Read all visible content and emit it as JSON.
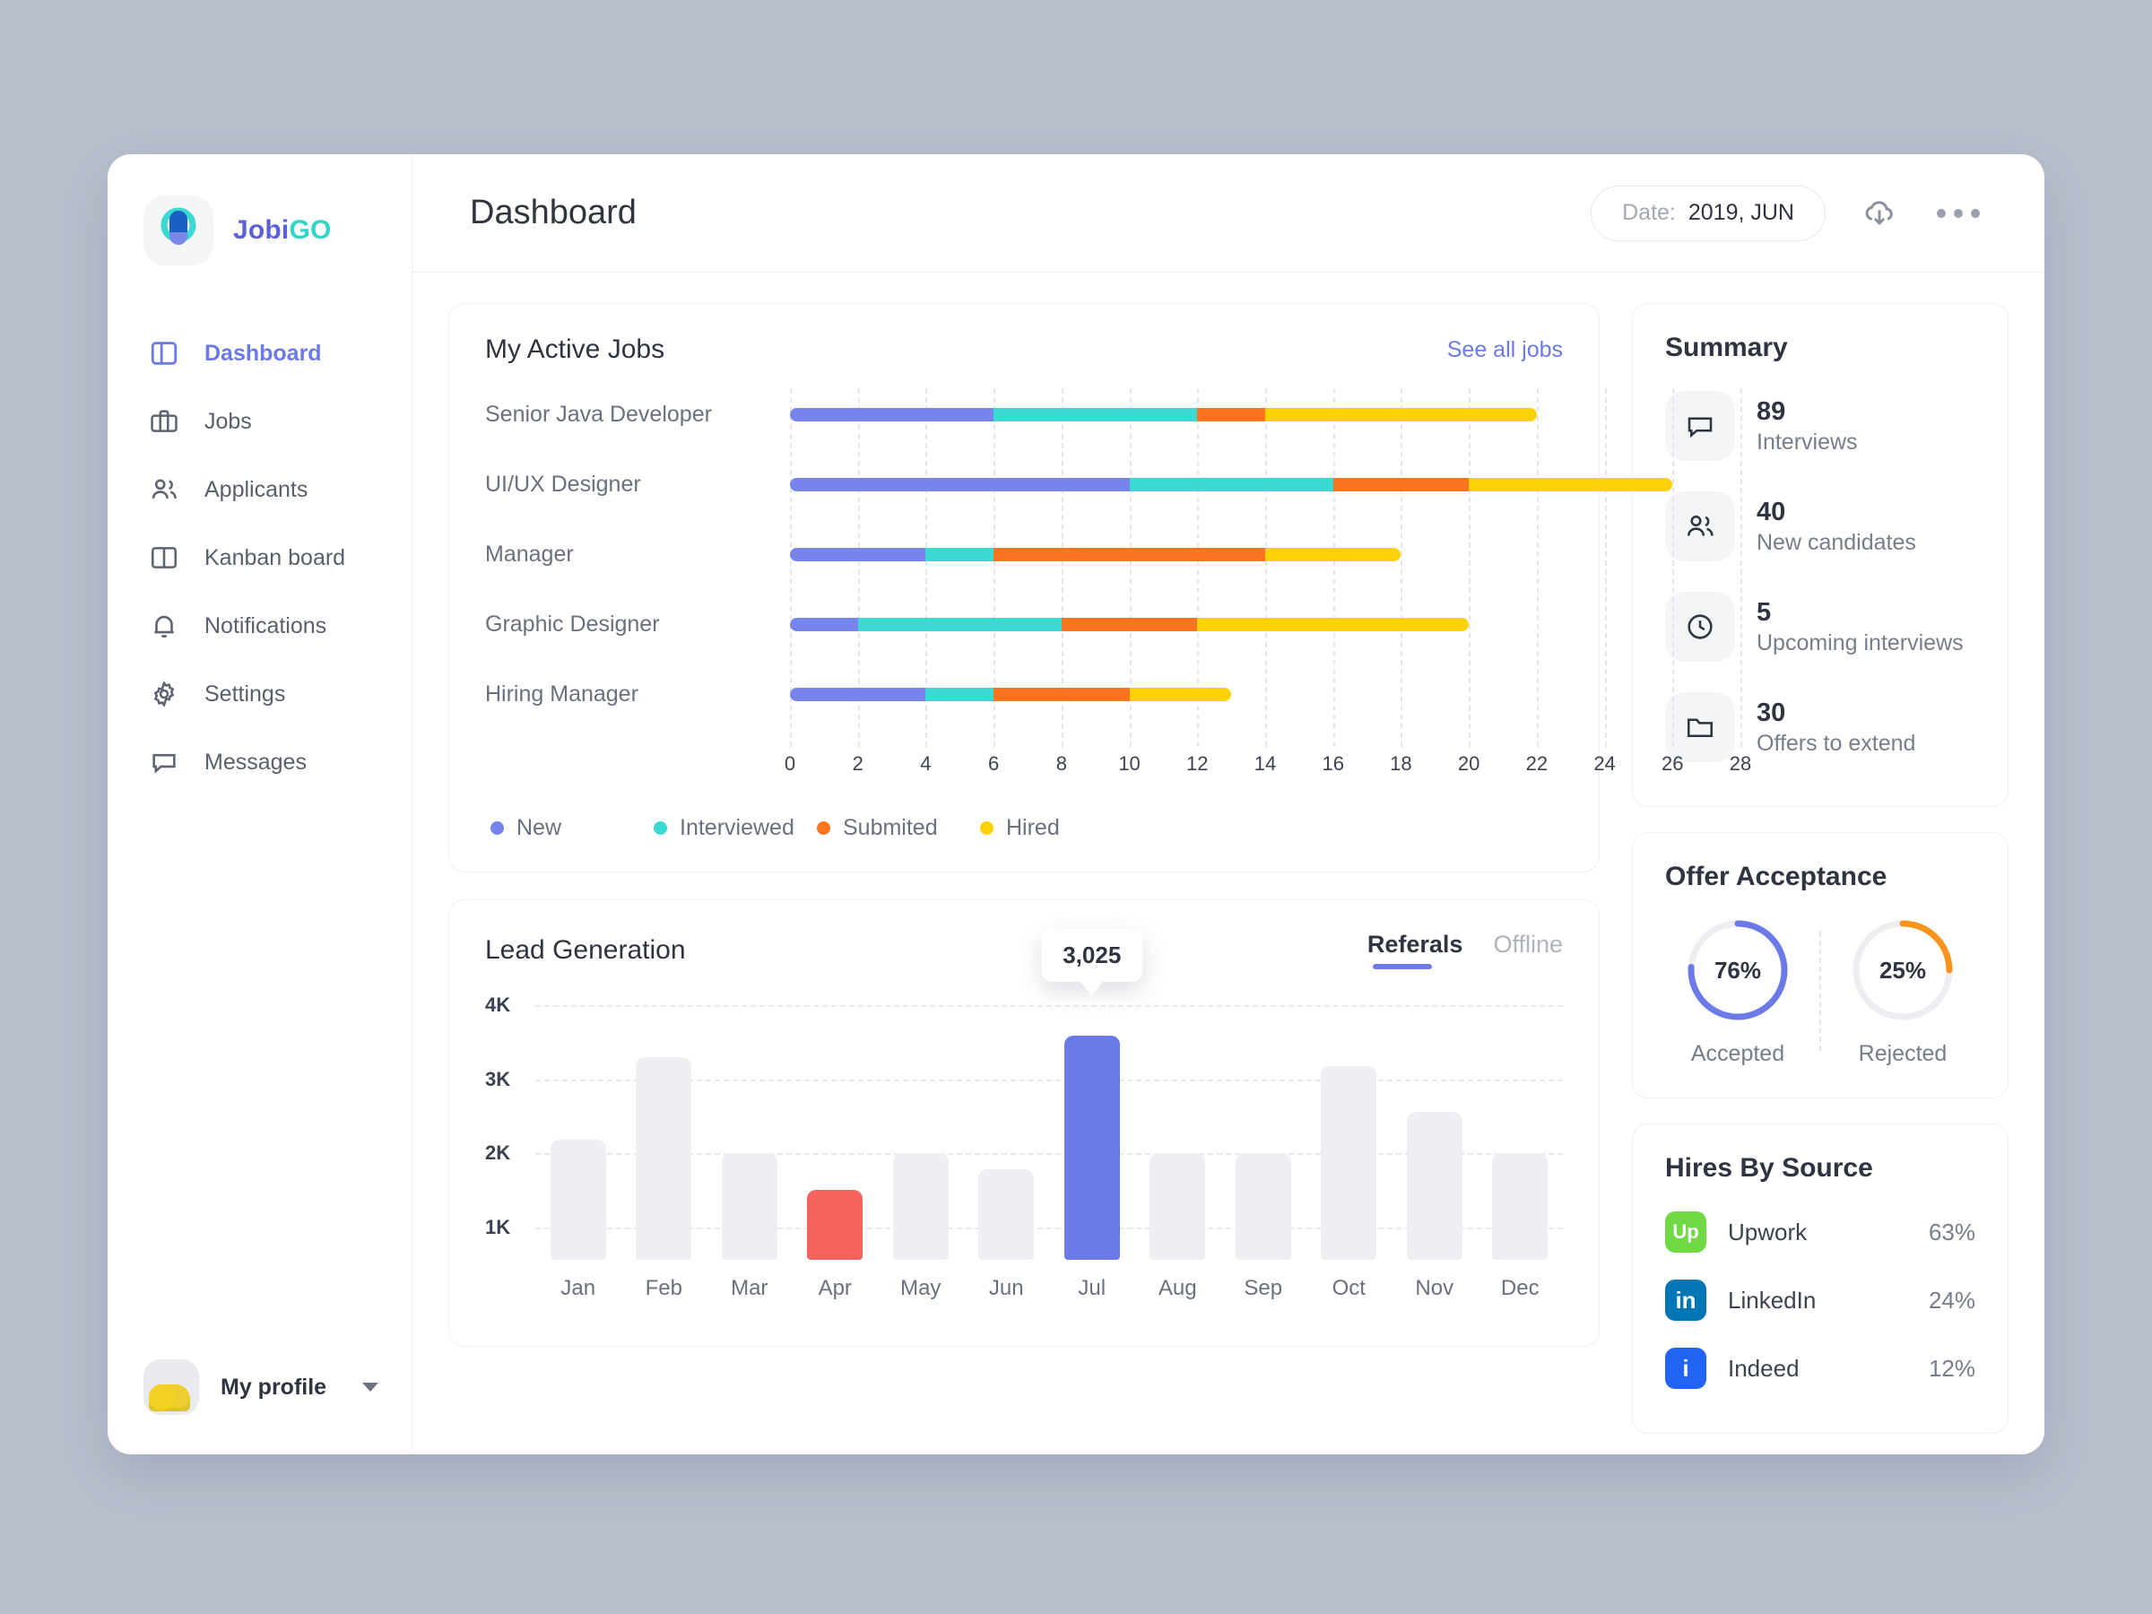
{
  "brand": {
    "part1": "Jobi",
    "part2": "GO"
  },
  "sidebar": {
    "items": [
      {
        "label": "Dashboard",
        "icon": "dashboard-icon",
        "active": true
      },
      {
        "label": "Jobs",
        "icon": "briefcase-icon",
        "active": false
      },
      {
        "label": "Applicants",
        "icon": "people-icon",
        "active": false
      },
      {
        "label": "Kanban board",
        "icon": "columns-icon",
        "active": false
      },
      {
        "label": "Notifications",
        "icon": "bell-icon",
        "active": false
      },
      {
        "label": "Settings",
        "icon": "gear-icon",
        "active": false
      },
      {
        "label": "Messages",
        "icon": "chat-icon",
        "active": false
      }
    ],
    "profile": {
      "label": "My profile",
      "avatar": "user-avatar",
      "caret": "chevron-down-icon"
    }
  },
  "header": {
    "title": "Dashboard",
    "date_label": "Date:",
    "date_value": "2019, JUN",
    "download_icon": "cloud-download-icon",
    "more_icon": "more-options-icon"
  },
  "active_jobs": {
    "title": "My Active Jobs",
    "see_all": "See all jobs"
  },
  "lead_generation": {
    "title": "Lead Generation",
    "tabs": [
      {
        "label": "Referals",
        "active": true
      },
      {
        "label": "Offline",
        "active": false
      }
    ]
  },
  "summary": {
    "title": "Summary",
    "items": [
      {
        "value": "89",
        "label": "Interviews",
        "icon": "chat-icon"
      },
      {
        "value": "40",
        "label": "New candidates",
        "icon": "people-icon"
      },
      {
        "value": "5",
        "label": "Upcoming interviews",
        "icon": "clock-icon"
      },
      {
        "value": "30",
        "label": "Offers to extend",
        "icon": "folder-icon"
      }
    ]
  },
  "offer_acceptance": {
    "title": "Offer Acceptance",
    "gauges": [
      {
        "value": "76%",
        "pct": 76,
        "label": "Accepted",
        "color": "#6c7ae8"
      },
      {
        "value": "25%",
        "pct": 25,
        "label": "Rejected",
        "color": "#f7941e"
      }
    ]
  },
  "hires_by_source": {
    "title": "Hires By Source",
    "items": [
      {
        "name": "Upwork",
        "pct": "63%",
        "icon": "upwork-logo",
        "color": "#6fda44",
        "glyph": "Up"
      },
      {
        "name": "LinkedIn",
        "pct": "24%",
        "icon": "linkedin-logo",
        "color": "#0077б5",
        "glyph": "in"
      },
      {
        "name": "Indeed",
        "pct": "12%",
        "icon": "indeed-logo",
        "color": "#2164f3",
        "glyph": "i"
      }
    ]
  },
  "chart_data": [
    {
      "type": "bar",
      "orientation": "horizontal",
      "stacked": true,
      "title": "My Active Jobs",
      "categories": [
        "Senior Java Developer",
        "UI/UX Designer",
        "Manager",
        "Graphic Designer",
        "Hiring Manager"
      ],
      "series": [
        {
          "name": "New",
          "color": "#7684eb",
          "values": [
            6,
            10,
            4,
            2,
            4
          ]
        },
        {
          "name": "Interviewed",
          "color": "#3ad9d2",
          "values": [
            6,
            6,
            2,
            6,
            2
          ]
        },
        {
          "name": "Submited",
          "color": "#fb7521",
          "values": [
            2,
            4,
            8,
            4,
            4
          ]
        },
        {
          "name": "Hired",
          "color": "#fbd208",
          "values": [
            8,
            6,
            4,
            8,
            3
          ]
        }
      ],
      "xlabel": "",
      "ylabel": "",
      "xlim": [
        0,
        28
      ],
      "xticks": [
        0,
        2,
        4,
        6,
        8,
        10,
        12,
        14,
        16,
        18,
        20,
        22,
        24,
        26,
        28
      ],
      "grid": true,
      "legend_position": "bottom"
    },
    {
      "type": "bar",
      "orientation": "vertical",
      "title": "Lead Generation",
      "categories": [
        "Jan",
        "Feb",
        "Mar",
        "Apr",
        "May",
        "Jun",
        "Jul",
        "Aug",
        "Sep",
        "Oct",
        "Nov",
        "Dec"
      ],
      "values": [
        1620,
        2740,
        1440,
        950,
        1440,
        1230,
        3025,
        1440,
        1440,
        2620,
        2000,
        1440
      ],
      "highlight": {
        "category": "Jul",
        "value": 3025,
        "label": "3,025",
        "color": "#6c7ae8"
      },
      "secondary_highlight": {
        "category": "Apr",
        "color": "#f4635c"
      },
      "bar_color": "#edeff3",
      "xlabel": "",
      "ylabel": "",
      "ylim": [
        0,
        4000
      ],
      "yticks": [
        1000,
        2000,
        3000,
        4000
      ],
      "ytick_labels": [
        "1K",
        "2K",
        "3K",
        "4K"
      ],
      "grid": true
    }
  ]
}
